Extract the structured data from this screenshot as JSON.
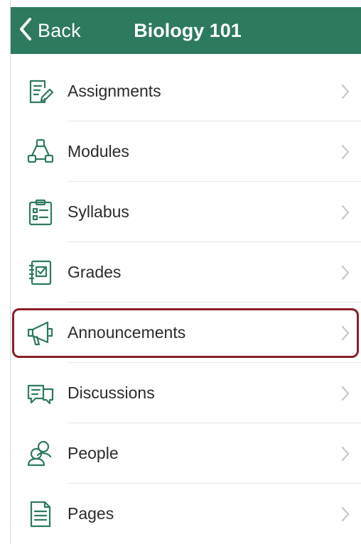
{
  "header": {
    "back_label": "Back",
    "title": "Biology 101",
    "background": "#2d7a5f"
  },
  "menu": {
    "items": [
      {
        "label": "Assignments",
        "icon": "assignment-icon"
      },
      {
        "label": "Modules",
        "icon": "modules-icon"
      },
      {
        "label": "Syllabus",
        "icon": "syllabus-icon"
      },
      {
        "label": "Grades",
        "icon": "grades-icon"
      },
      {
        "label": "Announcements",
        "icon": "megaphone-icon"
      },
      {
        "label": "Discussions",
        "icon": "discussion-icon",
        "highlighted": true
      },
      {
        "label": "People",
        "icon": "people-icon"
      },
      {
        "label": "Pages",
        "icon": "page-icon"
      }
    ]
  },
  "colors": {
    "accent": "#2d7a5f",
    "highlight_border": "#8a1f2a",
    "text": "#2b2b2b",
    "chevron": "#c7c7cc"
  }
}
